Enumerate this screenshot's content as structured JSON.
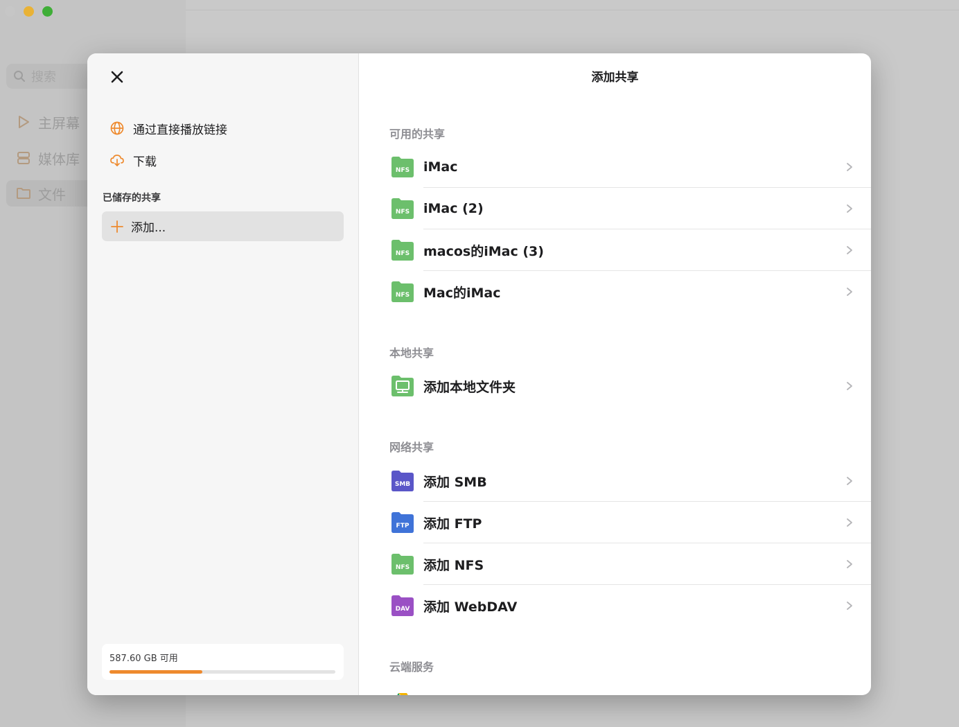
{
  "background": {
    "search_placeholder": "搜索",
    "nav": [
      {
        "label": "主屏幕",
        "icon": "play-icon"
      },
      {
        "label": "媒体库",
        "icon": "library-icon"
      },
      {
        "label": "文件",
        "icon": "folder-icon",
        "selected": true
      }
    ]
  },
  "modal": {
    "title": "添加共享",
    "left": {
      "items": [
        {
          "label": "通过直接播放链接",
          "icon": "globe-icon"
        },
        {
          "label": "下载",
          "icon": "cloud-download-icon"
        }
      ],
      "saved_section": "已储存的共享",
      "add_label": "添加...",
      "storage": {
        "text": "587.60 GB 可用",
        "used_fraction": 0.41
      }
    },
    "sections": [
      {
        "header": "可用的共享",
        "rows": [
          {
            "label": "iMac",
            "icon": "nfs-folder-icon",
            "badge": "NFS"
          },
          {
            "label": "iMac (2)",
            "icon": "nfs-folder-icon",
            "badge": "NFS"
          },
          {
            "label": "macos的iMac (3)",
            "icon": "nfs-folder-icon",
            "badge": "NFS"
          },
          {
            "label": "Mac的iMac",
            "icon": "nfs-folder-icon",
            "badge": "NFS"
          }
        ]
      },
      {
        "header": "本地共享",
        "rows": [
          {
            "label": "添加本地文件夹",
            "icon": "local-folder-icon"
          }
        ]
      },
      {
        "header": "网络共享",
        "rows": [
          {
            "label": "添加 SMB",
            "icon": "smb-folder-icon",
            "badge": "SMB"
          },
          {
            "label": "添加 FTP",
            "icon": "ftp-folder-icon",
            "badge": "FTP"
          },
          {
            "label": "添加 NFS",
            "icon": "nfs-folder-icon",
            "badge": "NFS"
          },
          {
            "label": "添加 WebDAV",
            "icon": "dav-folder-icon",
            "badge": "DAV"
          }
        ]
      },
      {
        "header": "云端服务",
        "rows": []
      }
    ]
  },
  "colors": {
    "accent_orange": "#ee8a2e",
    "nfs_green": "#6cbf6c",
    "smb_indigo": "#5a56c8",
    "ftp_blue": "#3f73d8",
    "dav_purple": "#9a50c4"
  }
}
